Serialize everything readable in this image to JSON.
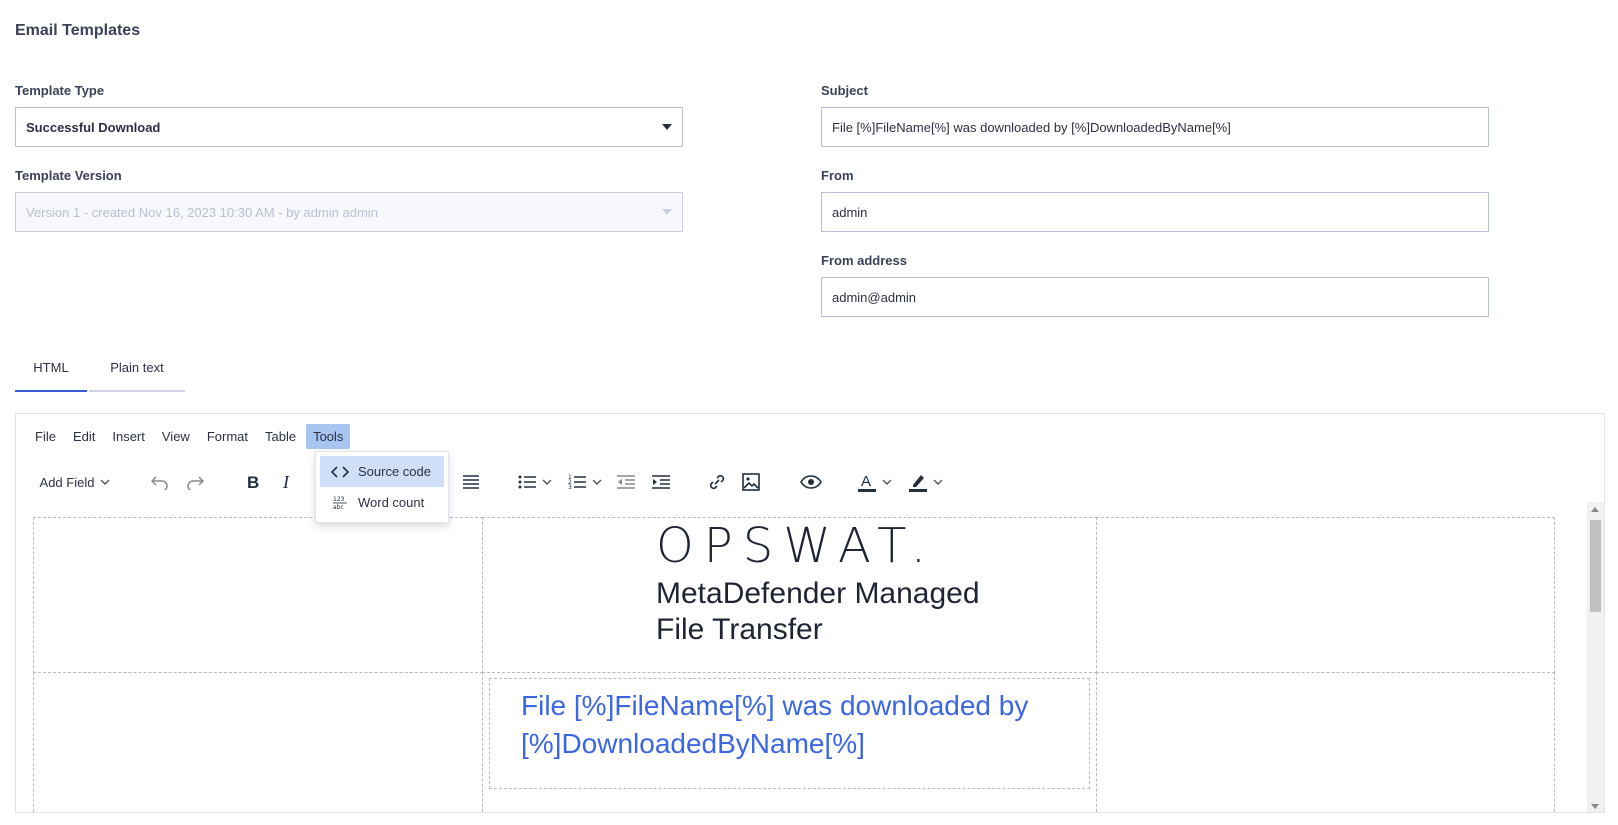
{
  "page": {
    "title": "Email Templates"
  },
  "form": {
    "template_type": {
      "label": "Template Type",
      "value": "Successful Download"
    },
    "template_version": {
      "label": "Template Version",
      "value": "Version 1 - created Nov 16, 2023 10:30 AM - by admin admin"
    },
    "subject": {
      "label": "Subject",
      "value": "File [%]FileName[%] was downloaded by [%]DownloadedByName[%]"
    },
    "from": {
      "label": "From",
      "value": "admin"
    },
    "from_address": {
      "label": "From address",
      "value": "admin@admin"
    }
  },
  "tabs": [
    {
      "label": "HTML",
      "active": true
    },
    {
      "label": "Plain text",
      "active": false
    }
  ],
  "editor": {
    "menu": [
      "File",
      "Edit",
      "Insert",
      "View",
      "Format",
      "Table",
      "Tools"
    ],
    "active_menu": "Tools",
    "toolbar": {
      "add_field_label": "Add Field",
      "icons": [
        "undo-icon",
        "redo-icon",
        "bold-icon",
        "italic-icon",
        "align-justify-icon",
        "bullet-list-icon",
        "numbered-list-icon",
        "outdent-icon",
        "indent-icon",
        "link-icon",
        "image-icon",
        "preview-icon",
        "text-color-icon",
        "highlight-icon"
      ]
    },
    "tools_menu": {
      "items": [
        {
          "label": "Source code",
          "icon": "source-code-icon"
        },
        {
          "label": "Word count",
          "icon": "word-count-icon"
        }
      ]
    },
    "content": {
      "logo_text": "OPSWAT.",
      "product_line1": "MetaDefender Managed",
      "product_line2": "File Transfer",
      "subject_line1": "File [%]FileName[%] was downloaded by",
      "subject_line2": "[%]DownloadedByName[%]"
    }
  },
  "colors": {
    "accent": "#3b5bdb",
    "link_text": "#3b67e5",
    "menu_active": "#a8c4f0"
  }
}
